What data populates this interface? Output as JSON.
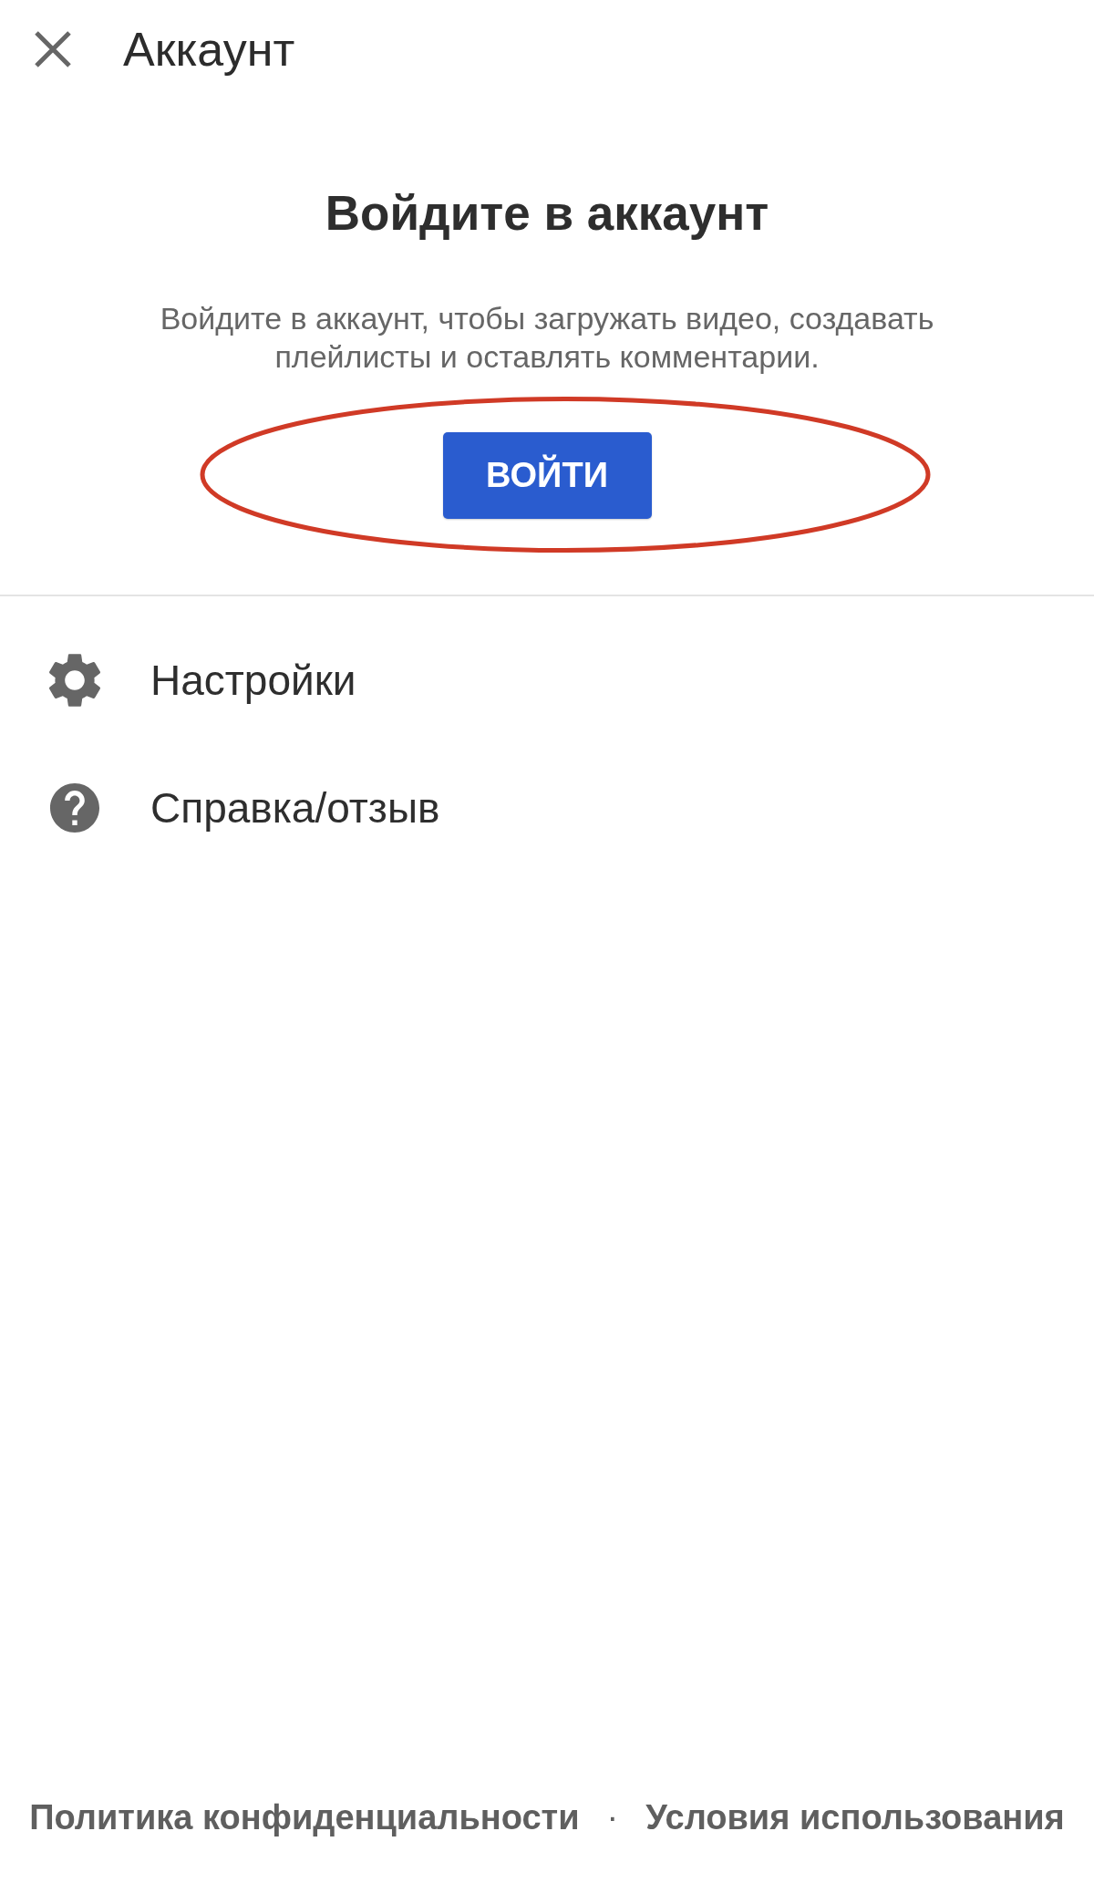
{
  "header": {
    "title": "Аккаунт"
  },
  "sign_in": {
    "heading": "Войдите в аккаунт",
    "description": "Войдите в аккаунт, чтобы загружать видео, создавать плейлисты и оставлять комментарии.",
    "button": "ВОЙТИ",
    "annotation": {
      "kind": "ellipse"
    }
  },
  "menu": [
    {
      "kind": "settings",
      "label": "Настройки"
    },
    {
      "kind": "help",
      "label": "Справка/отзыв"
    }
  ],
  "footer": {
    "links": [
      "Политика конфиденциальности",
      "Условия использования"
    ],
    "separator": "·"
  }
}
